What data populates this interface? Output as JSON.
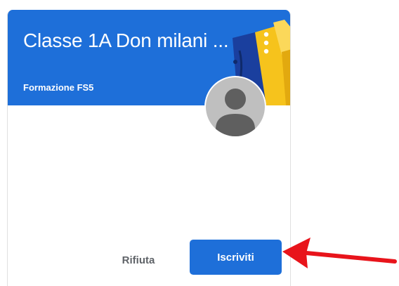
{
  "card": {
    "title": "Classe 1A Don milani ...",
    "subtitle": "Formazione FS5",
    "menu_icon": "more-vert-icon",
    "avatar_icon": "person-placeholder-icon"
  },
  "actions": {
    "reject_label": "Rifiuta",
    "join_label": "Iscriviti"
  },
  "annotation": {
    "arrow_icon": "arrow-left-icon",
    "arrow_color": "#e8141b"
  },
  "colors": {
    "header_blue": "#1e6fd9",
    "button_blue": "#1e6fd9",
    "avatar_gray": "#bfbfbf",
    "avatar_figure": "#5f5f5f"
  }
}
